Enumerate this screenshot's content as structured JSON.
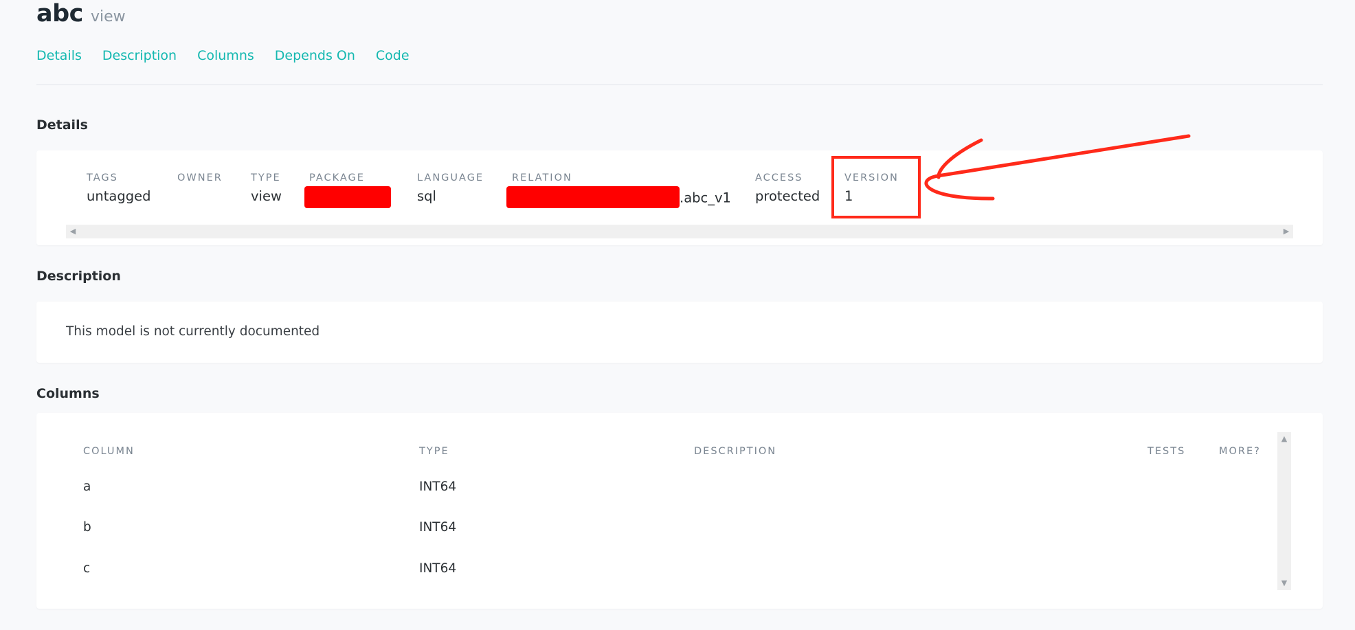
{
  "header": {
    "name": "abc",
    "type": "view"
  },
  "nav": [
    "Details",
    "Description",
    "Columns",
    "Depends On",
    "Code"
  ],
  "sections": {
    "details": "Details",
    "description": "Description",
    "columns": "Columns"
  },
  "details": {
    "tags": {
      "label": "TAGS",
      "value": "untagged"
    },
    "owner": {
      "label": "OWNER",
      "value": ""
    },
    "type": {
      "label": "TYPE",
      "value": "view"
    },
    "package": {
      "label": "PACKAGE",
      "value": ""
    },
    "language": {
      "label": "LANGUAGE",
      "value": "sql"
    },
    "relation": {
      "label": "RELATION",
      "value": ".abc_v1"
    },
    "access": {
      "label": "ACCESS",
      "value": "protected"
    },
    "version": {
      "label": "VERSION",
      "value": "1"
    }
  },
  "description": {
    "text": "This model is not currently documented"
  },
  "columns": {
    "headers": [
      "COLUMN",
      "TYPE",
      "DESCRIPTION",
      "TESTS",
      "MORE?"
    ],
    "rows": [
      {
        "name": "a",
        "type": "INT64"
      },
      {
        "name": "b",
        "type": "INT64"
      },
      {
        "name": "c",
        "type": "INT64"
      }
    ]
  },
  "icons": {
    "scroll_left": "scroll-left-icon",
    "scroll_right": "scroll-right-icon",
    "scroll_up": "scroll-up-icon",
    "scroll_down": "scroll-down-icon"
  },
  "colors": {
    "accent": "#14b8b0",
    "annotation": "#ff2a1a",
    "redaction": "#ff0000"
  }
}
